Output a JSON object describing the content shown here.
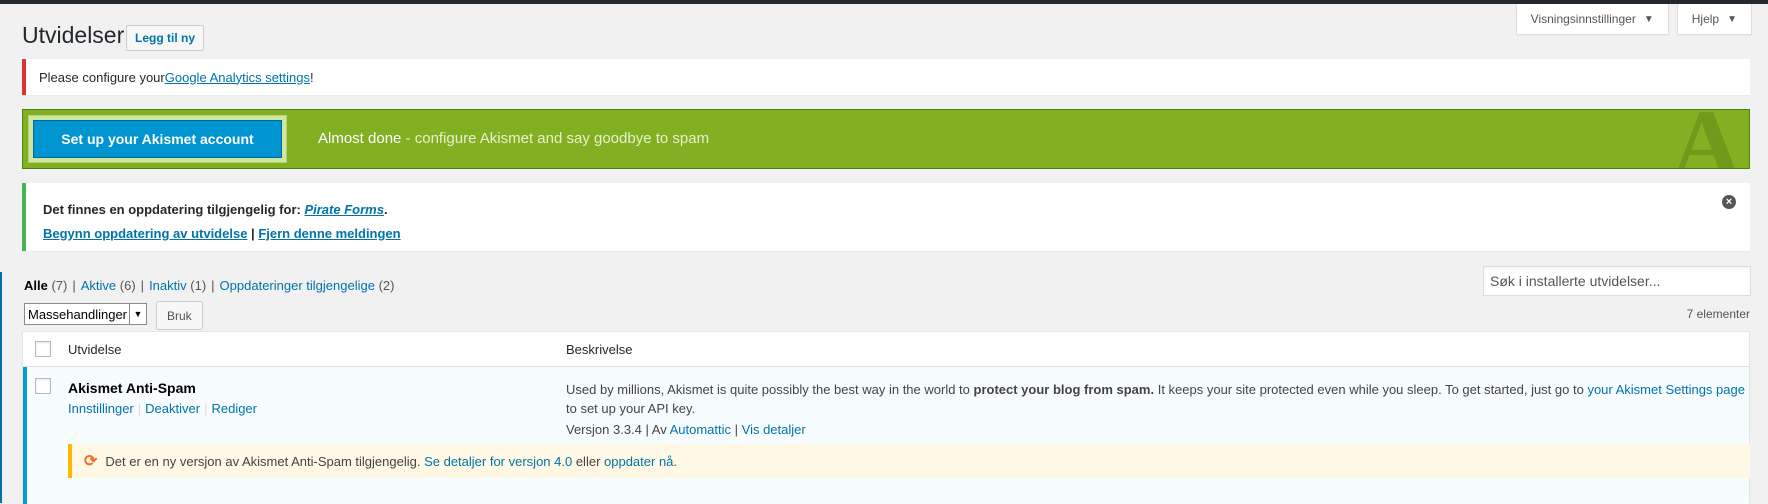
{
  "screen_meta": {
    "screen_options": "Visningsinnstillinger",
    "help": "Hjelp"
  },
  "page": {
    "title": "Utvidelser",
    "add_new": "Legg til ny"
  },
  "ga_notice": {
    "prefix": "Please configure your ",
    "link": "Google Analytics settings",
    "suffix": "!"
  },
  "akismet_banner": {
    "button": "Set up your Akismet account",
    "bold": "Almost done",
    "text": " - configure Akismet and say goodbye to spam",
    "logo": "A"
  },
  "update_notice": {
    "prefix": "Det finnes en oppdatering tilgjengelig for: ",
    "plugin": "Pirate Forms",
    "suffix": ".",
    "begin": "Begynn oppdatering av utvidelse",
    "sep": " | ",
    "dismiss": "Fjern denne meldingen"
  },
  "filters": [
    {
      "label": "Alle",
      "count": "(7)"
    },
    {
      "label": "Aktive",
      "count": "(6)"
    },
    {
      "label": "Inaktiv",
      "count": "(1)"
    },
    {
      "label": "Oppdateringer tilgjengelige",
      "count": "(2)"
    }
  ],
  "search": {
    "placeholder": "Søk i installerte utvidelser..."
  },
  "bulk": {
    "selected": "Massehandlinger",
    "apply": "Bruk"
  },
  "item_count": "7 elementer",
  "table": {
    "col_plugin": "Utvidelse",
    "col_description": "Beskrivelse",
    "rows": [
      {
        "name": "Akismet Anti-Spam",
        "actions": [
          "Innstillinger",
          "Deaktiver",
          "Rediger"
        ],
        "desc_1": "Used by millions, Akismet is quite possibly the best way in the world to ",
        "desc_bold": "protect your blog from spam.",
        "desc_2": " It keeps your site protected even while you sleep. To get started, just go to ",
        "desc_link": "your Akismet Settings page",
        "desc_3": " to set up your API key.",
        "version": "Versjon 3.3.4",
        "by": " | Av ",
        "author": "Automattic",
        "details": "Vis detaljer",
        "update_1": "Det er en ny versjon av Akismet Anti-Spam tilgjengelig. ",
        "update_link": "Se detaljer for versjon 4.0",
        "update_2": " eller ",
        "update_now": "oppdater nå",
        "update_3": "."
      }
    ]
  }
}
